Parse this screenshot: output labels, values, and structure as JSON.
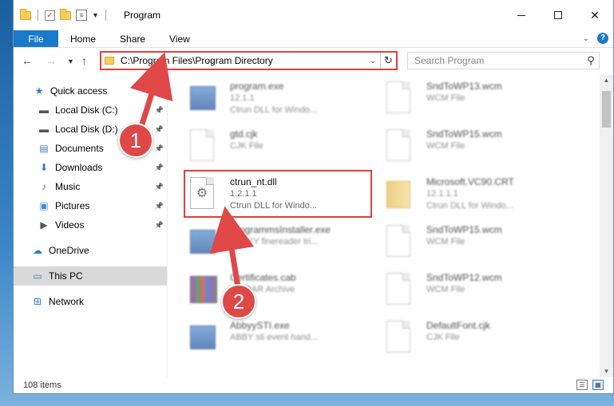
{
  "window": {
    "title": "Program"
  },
  "ribbon": {
    "tabs": [
      "File",
      "Home",
      "Share",
      "View"
    ]
  },
  "nav": {
    "address": "C:\\Program Files\\Program Directory",
    "search_placeholder": "Search Program"
  },
  "sidebar": {
    "items": [
      {
        "label": "Quick access",
        "icon": "star-icon",
        "pinned": false
      },
      {
        "label": "Local Disk (C:)",
        "icon": "drive-icon",
        "pinned": true
      },
      {
        "label": "Local Disk (D:)",
        "icon": "drive-icon",
        "pinned": true
      },
      {
        "label": "Documents",
        "icon": "documents-icon",
        "pinned": true
      },
      {
        "label": "Downloads",
        "icon": "download-icon",
        "pinned": true
      },
      {
        "label": "Music",
        "icon": "music-icon",
        "pinned": true
      },
      {
        "label": "Pictures",
        "icon": "pictures-icon",
        "pinned": true
      },
      {
        "label": "Videos",
        "icon": "videos-icon",
        "pinned": true
      },
      {
        "label": "OneDrive",
        "icon": "cloud-icon",
        "pinned": false
      },
      {
        "label": "This PC",
        "icon": "computer-icon",
        "pinned": false,
        "selected": true
      },
      {
        "label": "Network",
        "icon": "network-icon",
        "pinned": false
      }
    ]
  },
  "files": {
    "left": [
      {
        "name": "program.exe",
        "line2": "12.1.1",
        "line3": "Ctrun DLL for Windo...",
        "icon": "exe-icon"
      },
      {
        "name": "gtd.cjk",
        "line2": "CJK File",
        "line3": "",
        "icon": "doc-icon"
      },
      {
        "name": "ctrun_nt.dll",
        "line2": "1.2.1.1",
        "line3": "Ctrun DLL for Windo...",
        "icon": "dll-gear-icon",
        "highlighted": true
      },
      {
        "name": "ProgrammsInstaller.exe",
        "line2": "ABBYY finereader tri...",
        "line3": "",
        "icon": "exe-icon"
      },
      {
        "name": "Certificates.cab",
        "line2": "WinRAR Archive",
        "line3": "",
        "icon": "archive-icon"
      },
      {
        "name": "AbbyySTI.exe",
        "line2": "ABBY sti event hand...",
        "line3": "",
        "icon": "exe-icon"
      }
    ],
    "right": [
      {
        "name": "SndToWP13.wcm",
        "line2": "WCM File",
        "line3": "",
        "icon": "doc-icon"
      },
      {
        "name": "SndToWP15.wcm",
        "line2": "WCM File",
        "line3": "",
        "icon": "doc-icon"
      },
      {
        "name": "Microsoft.VC90.CRT",
        "line2": "12.1.1.1",
        "line3": "Ctrun DLL for Windo...",
        "icon": "folder-icon"
      },
      {
        "name": "SndToWP15.wcm",
        "line2": "WCM File",
        "line3": "",
        "icon": "doc-icon"
      },
      {
        "name": "SndToWP12.wcm",
        "line2": "WCM File",
        "line3": "",
        "icon": "doc-icon"
      },
      {
        "name": "DefaultFont.cjk",
        "line2": "CJK File",
        "line3": "",
        "icon": "doc-icon"
      }
    ]
  },
  "status": {
    "count": "108 items"
  },
  "callouts": {
    "one": "1",
    "two": "2"
  }
}
